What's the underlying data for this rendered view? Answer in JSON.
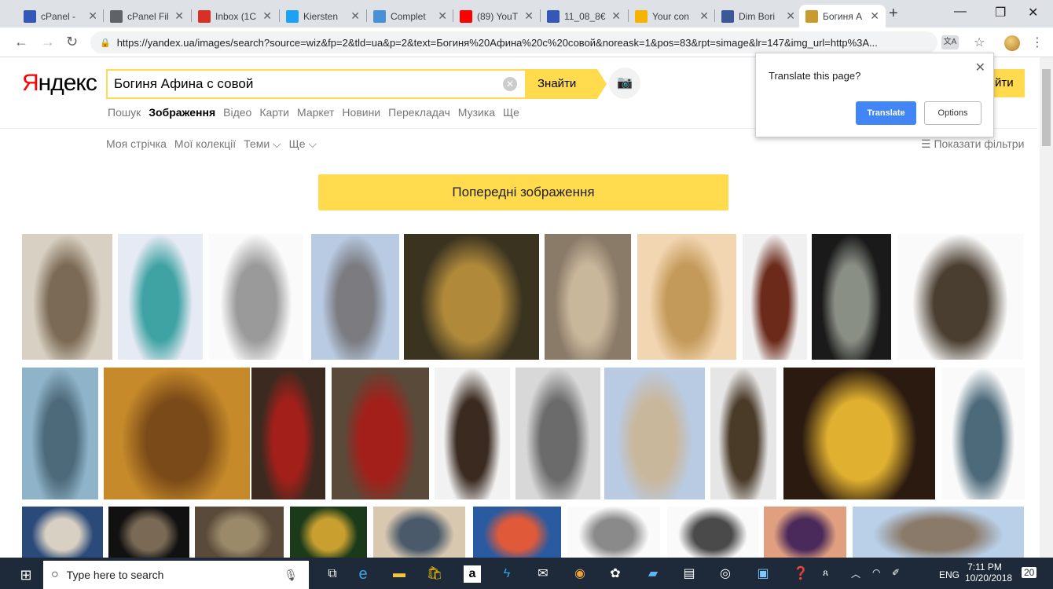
{
  "browser": {
    "tabs": [
      {
        "title": "cPanel - ",
        "icon": "grid",
        "color": "#3557b7"
      },
      {
        "title": "cPanel Fil",
        "icon": "doc",
        "color": "#5f6368"
      },
      {
        "title": "Inbox (1C",
        "icon": "M",
        "color": "#d93025"
      },
      {
        "title": "Kiersten",
        "icon": "bird",
        "color": "#1da1f2"
      },
      {
        "title": "Complet",
        "icon": "globe",
        "color": "#4a90d9"
      },
      {
        "title": "(89) YouT",
        "icon": "play",
        "color": "#ff0000"
      },
      {
        "title": "11_08_8€",
        "icon": "grid",
        "color": "#3557b7"
      },
      {
        "title": "Your con",
        "icon": "hand",
        "color": "#f4b400"
      },
      {
        "title": "Dim Bori",
        "icon": "f",
        "color": "#3b5998"
      },
      {
        "title": "Богиня А",
        "icon": "img",
        "color": "#c99a2e"
      }
    ],
    "url": "https://yandex.ua/images/search?source=wiz&fp=2&tld=ua&p=2&text=Богиня%20Афина%20с%20совой&noreask=1&pos=83&rpt=simage&lr=147&img_url=http%3A..."
  },
  "page": {
    "logo_first": "Я",
    "logo_rest": "ндекс",
    "search_value": "Богиня Афина с совой",
    "find_label": "Знайти",
    "services": [
      "Пошук",
      "Зображення",
      "Відео",
      "Карти",
      "Маркет",
      "Новини",
      "Перекладач",
      "Музика",
      "Ще"
    ],
    "subnav": [
      "Моя стрічка",
      "Мої колекції",
      "Теми ⌵",
      "Ще ⌵"
    ],
    "filters_label": "Показати фільтри",
    "prev_images_label": "Попередні зображення",
    "peek_label": "йти"
  },
  "translate_popup": {
    "question": "Translate this page?",
    "translate_label": "Translate",
    "options_label": "Options"
  },
  "taskbar": {
    "search_placeholder": "Type here to search",
    "lang": "ENG",
    "time": "7:11 PM",
    "date": "10/20/2018",
    "notifications": "20"
  }
}
